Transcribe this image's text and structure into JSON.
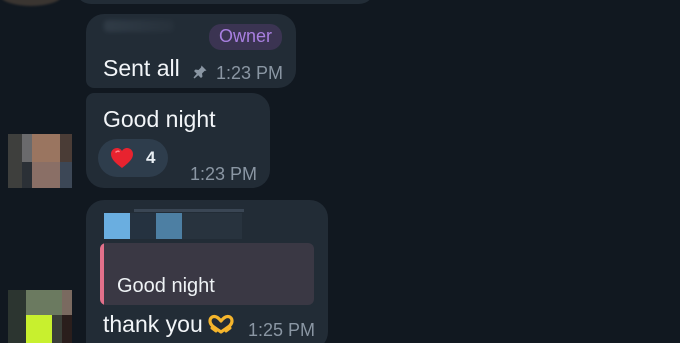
{
  "messages": [
    {
      "id": "m1",
      "badge": "Owner",
      "text": "Sent all",
      "time": "1:23 PM",
      "status_icon": "pin-icon"
    },
    {
      "id": "m2",
      "text": "Good night",
      "time": "1:23 PM",
      "reaction": {
        "emoji": "heart-icon",
        "count": "4"
      }
    },
    {
      "id": "m3",
      "reply_to": {
        "text": "Good night"
      },
      "text": "thank you",
      "emoji": "heart-hands-icon",
      "time": "1:25 PM"
    }
  ],
  "colors": {
    "background": "#111820",
    "bubble": "#222c36",
    "owner_badge_text": "#a87fe0",
    "reply_accent": "#e2708a",
    "time_text": "#8a96a3"
  }
}
